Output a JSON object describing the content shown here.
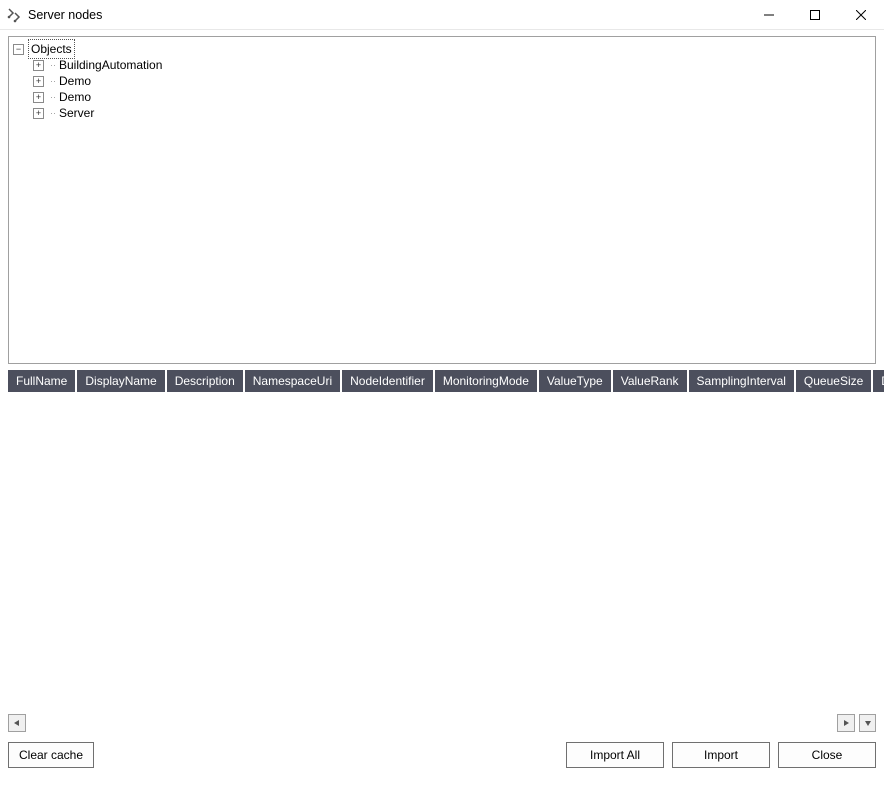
{
  "window": {
    "title": "Server nodes"
  },
  "tree": {
    "root": {
      "label": "Objects",
      "expanded": true
    },
    "children": [
      {
        "label": "BuildingAutomation",
        "expanded": false
      },
      {
        "label": "Demo",
        "expanded": false
      },
      {
        "label": "Demo",
        "expanded": false
      },
      {
        "label": "Server",
        "expanded": false
      }
    ]
  },
  "grid": {
    "columns": [
      "FullName",
      "DisplayName",
      "Description",
      "NamespaceUri",
      "NodeIdentifier",
      "MonitoringMode",
      "ValueType",
      "ValueRank",
      "SamplingInterval",
      "QueueSize",
      "DiscardOldest"
    ],
    "rows": []
  },
  "buttons": {
    "clear_cache": "Clear cache",
    "import_all": "Import All",
    "import": "Import",
    "close": "Close"
  }
}
